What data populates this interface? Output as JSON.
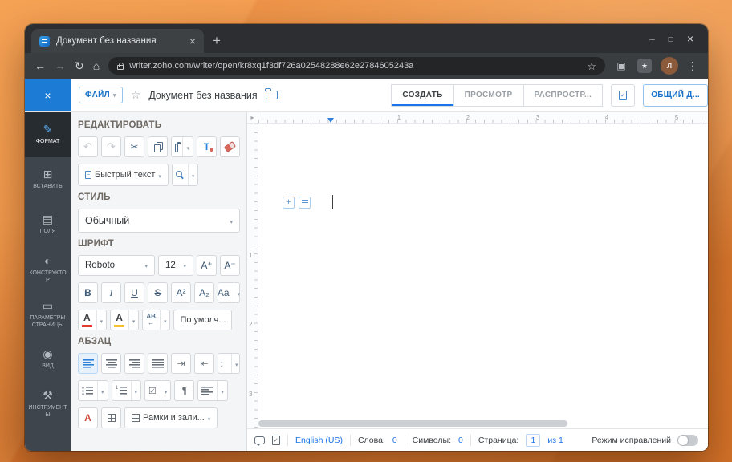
{
  "browser": {
    "tab_title": "Документ без названия",
    "url": "writer.zoho.com/writer/open/kr8xq1f3df726a02548288e62e2784605243a",
    "avatar_initial": "л"
  },
  "topbar": {
    "file_label": "ФАЙЛ",
    "doc_title": "Документ без названия",
    "create_label": "СОЗДАТЬ",
    "preview_label": "ПРОСМОТР",
    "distribute_label": "РАСПРОСТР...",
    "share_label": "ОБЩИЙ Д..."
  },
  "sidebar": {
    "items": [
      {
        "label": "ФОРМАТ"
      },
      {
        "label": "ВСТАВИТЬ"
      },
      {
        "label": "ПОЛЯ"
      },
      {
        "label": "КОНСТРУКТОР"
      },
      {
        "label": "ПАРАМЕТРЫ СТРАНИЦЫ"
      },
      {
        "label": "ВИД"
      },
      {
        "label": "ИНСТРУМЕНТЫ"
      }
    ]
  },
  "panel": {
    "edit_header": "РЕДАКТИРОВАТЬ",
    "quick_text_label": "Быстрый текст",
    "style_header": "СТИЛЬ",
    "style_value": "Обычный",
    "font_header": "ШРИФТ",
    "font_family": "Roboto",
    "font_size": "12",
    "grow_label": "A⁺",
    "shrink_label": "A⁻",
    "bold_label": "B",
    "italic_label": "I",
    "underline_label": "U",
    "strike_label": "S",
    "superscript_label": "A²",
    "subscript_label": "A₂",
    "case_label": "Aa",
    "font_color_label": "A",
    "highlight_label": "A",
    "spacing_label": "AB",
    "default_label": "По умолч...",
    "paragraph_header": "АБЗАЦ",
    "char_style_label": "А",
    "borders_label": "Рамки и зали..."
  },
  "statusbar": {
    "language": "English (US)",
    "words_label": "Слова:",
    "words_value": "0",
    "chars_label": "Символы:",
    "chars_value": "0",
    "page_label": "Страница:",
    "page_value": "1",
    "page_total": "из 1",
    "track_label": "Режим исправлений"
  },
  "doc": {
    "hruler": [
      "1",
      "2",
      "3",
      "4",
      "5"
    ],
    "vruler": [
      "1",
      "2",
      "3"
    ]
  }
}
